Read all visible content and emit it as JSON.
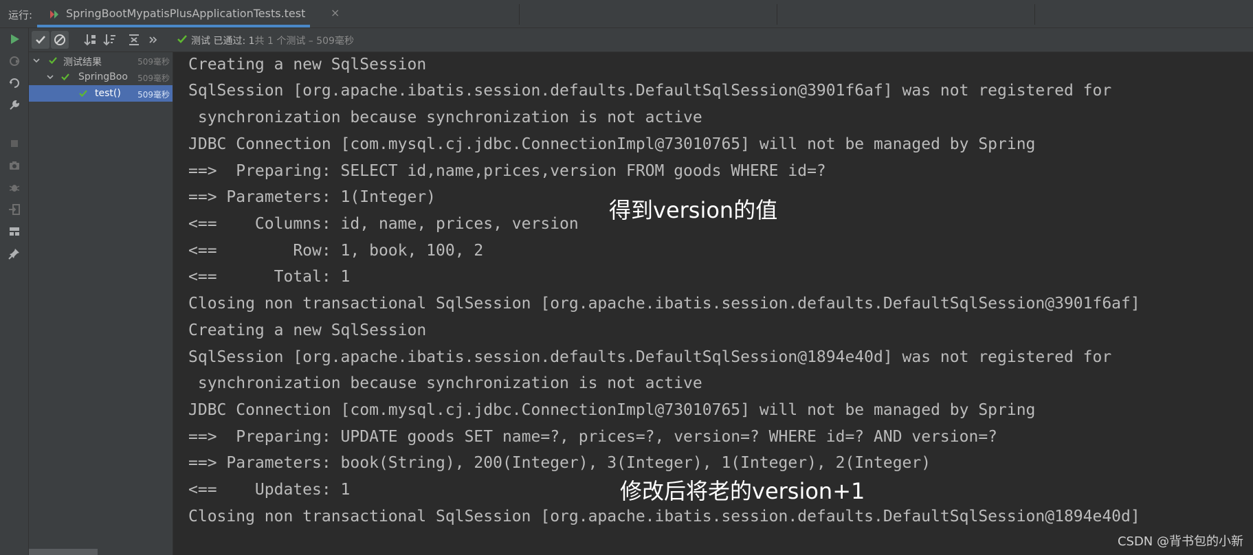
{
  "run_bar": {
    "label": "运行:",
    "tab_title": "SpringBootMypatisPlusApplicationTests.test",
    "close_glyph": "×"
  },
  "toolbar": {
    "status_prefix": "测试 已通过: 1",
    "status_detail": "共 1 个测试 – 509毫秒"
  },
  "tree": {
    "items": [
      {
        "label": "测试结果",
        "time": "509毫秒"
      },
      {
        "label": "SpringBoo",
        "time": "509毫秒"
      },
      {
        "label": "test()",
        "time": "509毫秒"
      }
    ]
  },
  "console": {
    "lines": [
      "Creating a new SqlSession",
      "SqlSession [org.apache.ibatis.session.defaults.DefaultSqlSession@3901f6af] was not registered for",
      " synchronization because synchronization is not active",
      "JDBC Connection [com.mysql.cj.jdbc.ConnectionImpl@73010765] will not be managed by Spring",
      "==>  Preparing: SELECT id,name,prices,version FROM goods WHERE id=?",
      "==> Parameters: 1(Integer)",
      "<==    Columns: id, name, prices, version",
      "<==        Row: 1, book, 100, 2",
      "<==      Total: 1",
      "Closing non transactional SqlSession [org.apache.ibatis.session.defaults.DefaultSqlSession@3901f6af]",
      "Creating a new SqlSession",
      "SqlSession [org.apache.ibatis.session.defaults.DefaultSqlSession@1894e40d] was not registered for",
      " synchronization because synchronization is not active",
      "JDBC Connection [com.mysql.cj.jdbc.ConnectionImpl@73010765] will not be managed by Spring",
      "==>  Preparing: UPDATE goods SET name=?, prices=?, version=? WHERE id=? AND version=?",
      "==> Parameters: book(String), 200(Integer), 3(Integer), 1(Integer), 2(Integer)",
      "<==    Updates: 1",
      "Closing non transactional SqlSession [org.apache.ibatis.session.defaults.DefaultSqlSession@1894e40d]"
    ]
  },
  "annotations": {
    "version_value": "得到version的值",
    "version_increment": "修改后将老的version+1"
  },
  "watermark": "CSDN @背书包的小新",
  "icons": {
    "rerun": "play-icon",
    "show_passed": "check-icon",
    "show_ignored": "cancel-circle-icon",
    "sort_alpha": "sort-alpha-icon",
    "sort_duration": "sort-duration-icon",
    "expand_all": "expand-all-icon",
    "more": "chevron-double-right-icon"
  },
  "colors": {
    "pass_green": "#5fb832",
    "selection": "#4b6eaf",
    "tab_underline": "#4a88c7",
    "run_green": "#59a869"
  }
}
